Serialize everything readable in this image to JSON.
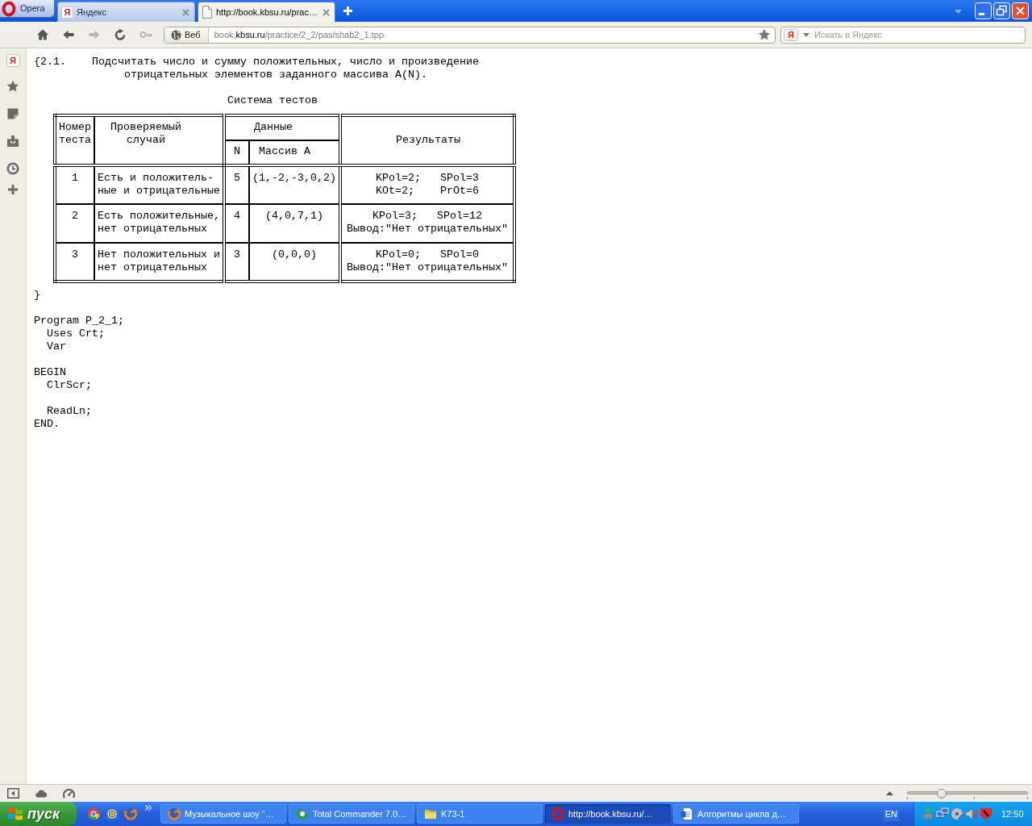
{
  "browser": {
    "menu_button": "Opera",
    "tabs": [
      {
        "title": "Яндекс",
        "kind": "logo",
        "badge": "Я",
        "selected": false
      },
      {
        "title": "http://book.kbsu.ru/prac…",
        "kind": "page",
        "selected": true
      }
    ],
    "address": {
      "mode": "Веб",
      "url_parts": [
        {
          "text": "book.",
          "highlighted": false
        },
        {
          "text": "kbsu.ru",
          "highlighted": true
        },
        {
          "text": "/practice/2_2/pas/shab2_1.tpp",
          "highlighted": false
        }
      ]
    },
    "search": {
      "engine": "Я",
      "placeholder": "Искать в Яндекс"
    }
  },
  "sidebar": {
    "logo": "Я"
  },
  "page": {
    "task": {
      "number": "{2.1.",
      "lines": [
        "Подсчитать число и сумму положительных, число и произведение",
        "отрицательных элементов заданного массива A(N)."
      ]
    },
    "table_title": "Система тестов",
    "table": {
      "headers": {
        "number": [
          "Номер",
          "теста"
        ],
        "case": [
          "Проверяемый",
          "случай"
        ],
        "data": "Данные",
        "n": "N",
        "array": "Массив A",
        "results": "Результаты"
      },
      "rows": [
        {
          "number": "1",
          "case": [
            "Есть и положитель-",
            "ные и отрицательные"
          ],
          "n": "5",
          "array": "(1,-2,-3,0,2)",
          "results": [
            "KPol=2;   SPol=3",
            "KOt=2;    PrOt=6"
          ]
        },
        {
          "number": "2",
          "case": [
            "Есть положительные,",
            "нет отрицательных"
          ],
          "n": "4",
          "array": "(4,0,7,1)",
          "results": [
            "KPol=3;   SPol=12",
            "Вывод:\"Нет отрицательных\""
          ]
        },
        {
          "number": "3",
          "case": [
            "Нет положительных и",
            "нет отрицательных"
          ],
          "n": "3",
          "array": "(0,0,0)",
          "results": [
            "KPol=0;   SPol=0",
            "Вывод:\"Нет отрицательных\""
          ]
        }
      ]
    },
    "closing_brace": "}",
    "code": [
      [
        {
          "text": "Program P_2_1;",
          "children": [
            [
              {
                "text": "Uses Crt;"
              },
              {
                "text": "Var"
              }
            ]
          ]
        }
      ],
      [
        {
          "text": "BEGIN",
          "children": [
            [
              {
                "text": "ClrScr;"
              }
            ],
            [
              {
                "text": "ReadLn;"
              }
            ]
          ]
        },
        {
          "text": "END."
        }
      ]
    ]
  },
  "status_bar": {
    "zoom_slider": {
      "level": 0.27
    }
  },
  "taskbar": {
    "start_label": "пуск",
    "tasks": [
      {
        "title": "Музыкальное шоу “…",
        "kind": "firefox",
        "selected": false
      },
      {
        "title": "Total Commander 7.0…",
        "kind": "commander",
        "selected": false
      },
      {
        "title": "K73-1",
        "kind": "folder",
        "selected": false
      },
      {
        "title": "http://book.kbsu.ru/…",
        "kind": "opera",
        "selected": true
      },
      {
        "title": "Алгоритмы цикла д…",
        "kind": "document",
        "selected": false
      }
    ],
    "language": "EN",
    "clock": "12:50"
  }
}
